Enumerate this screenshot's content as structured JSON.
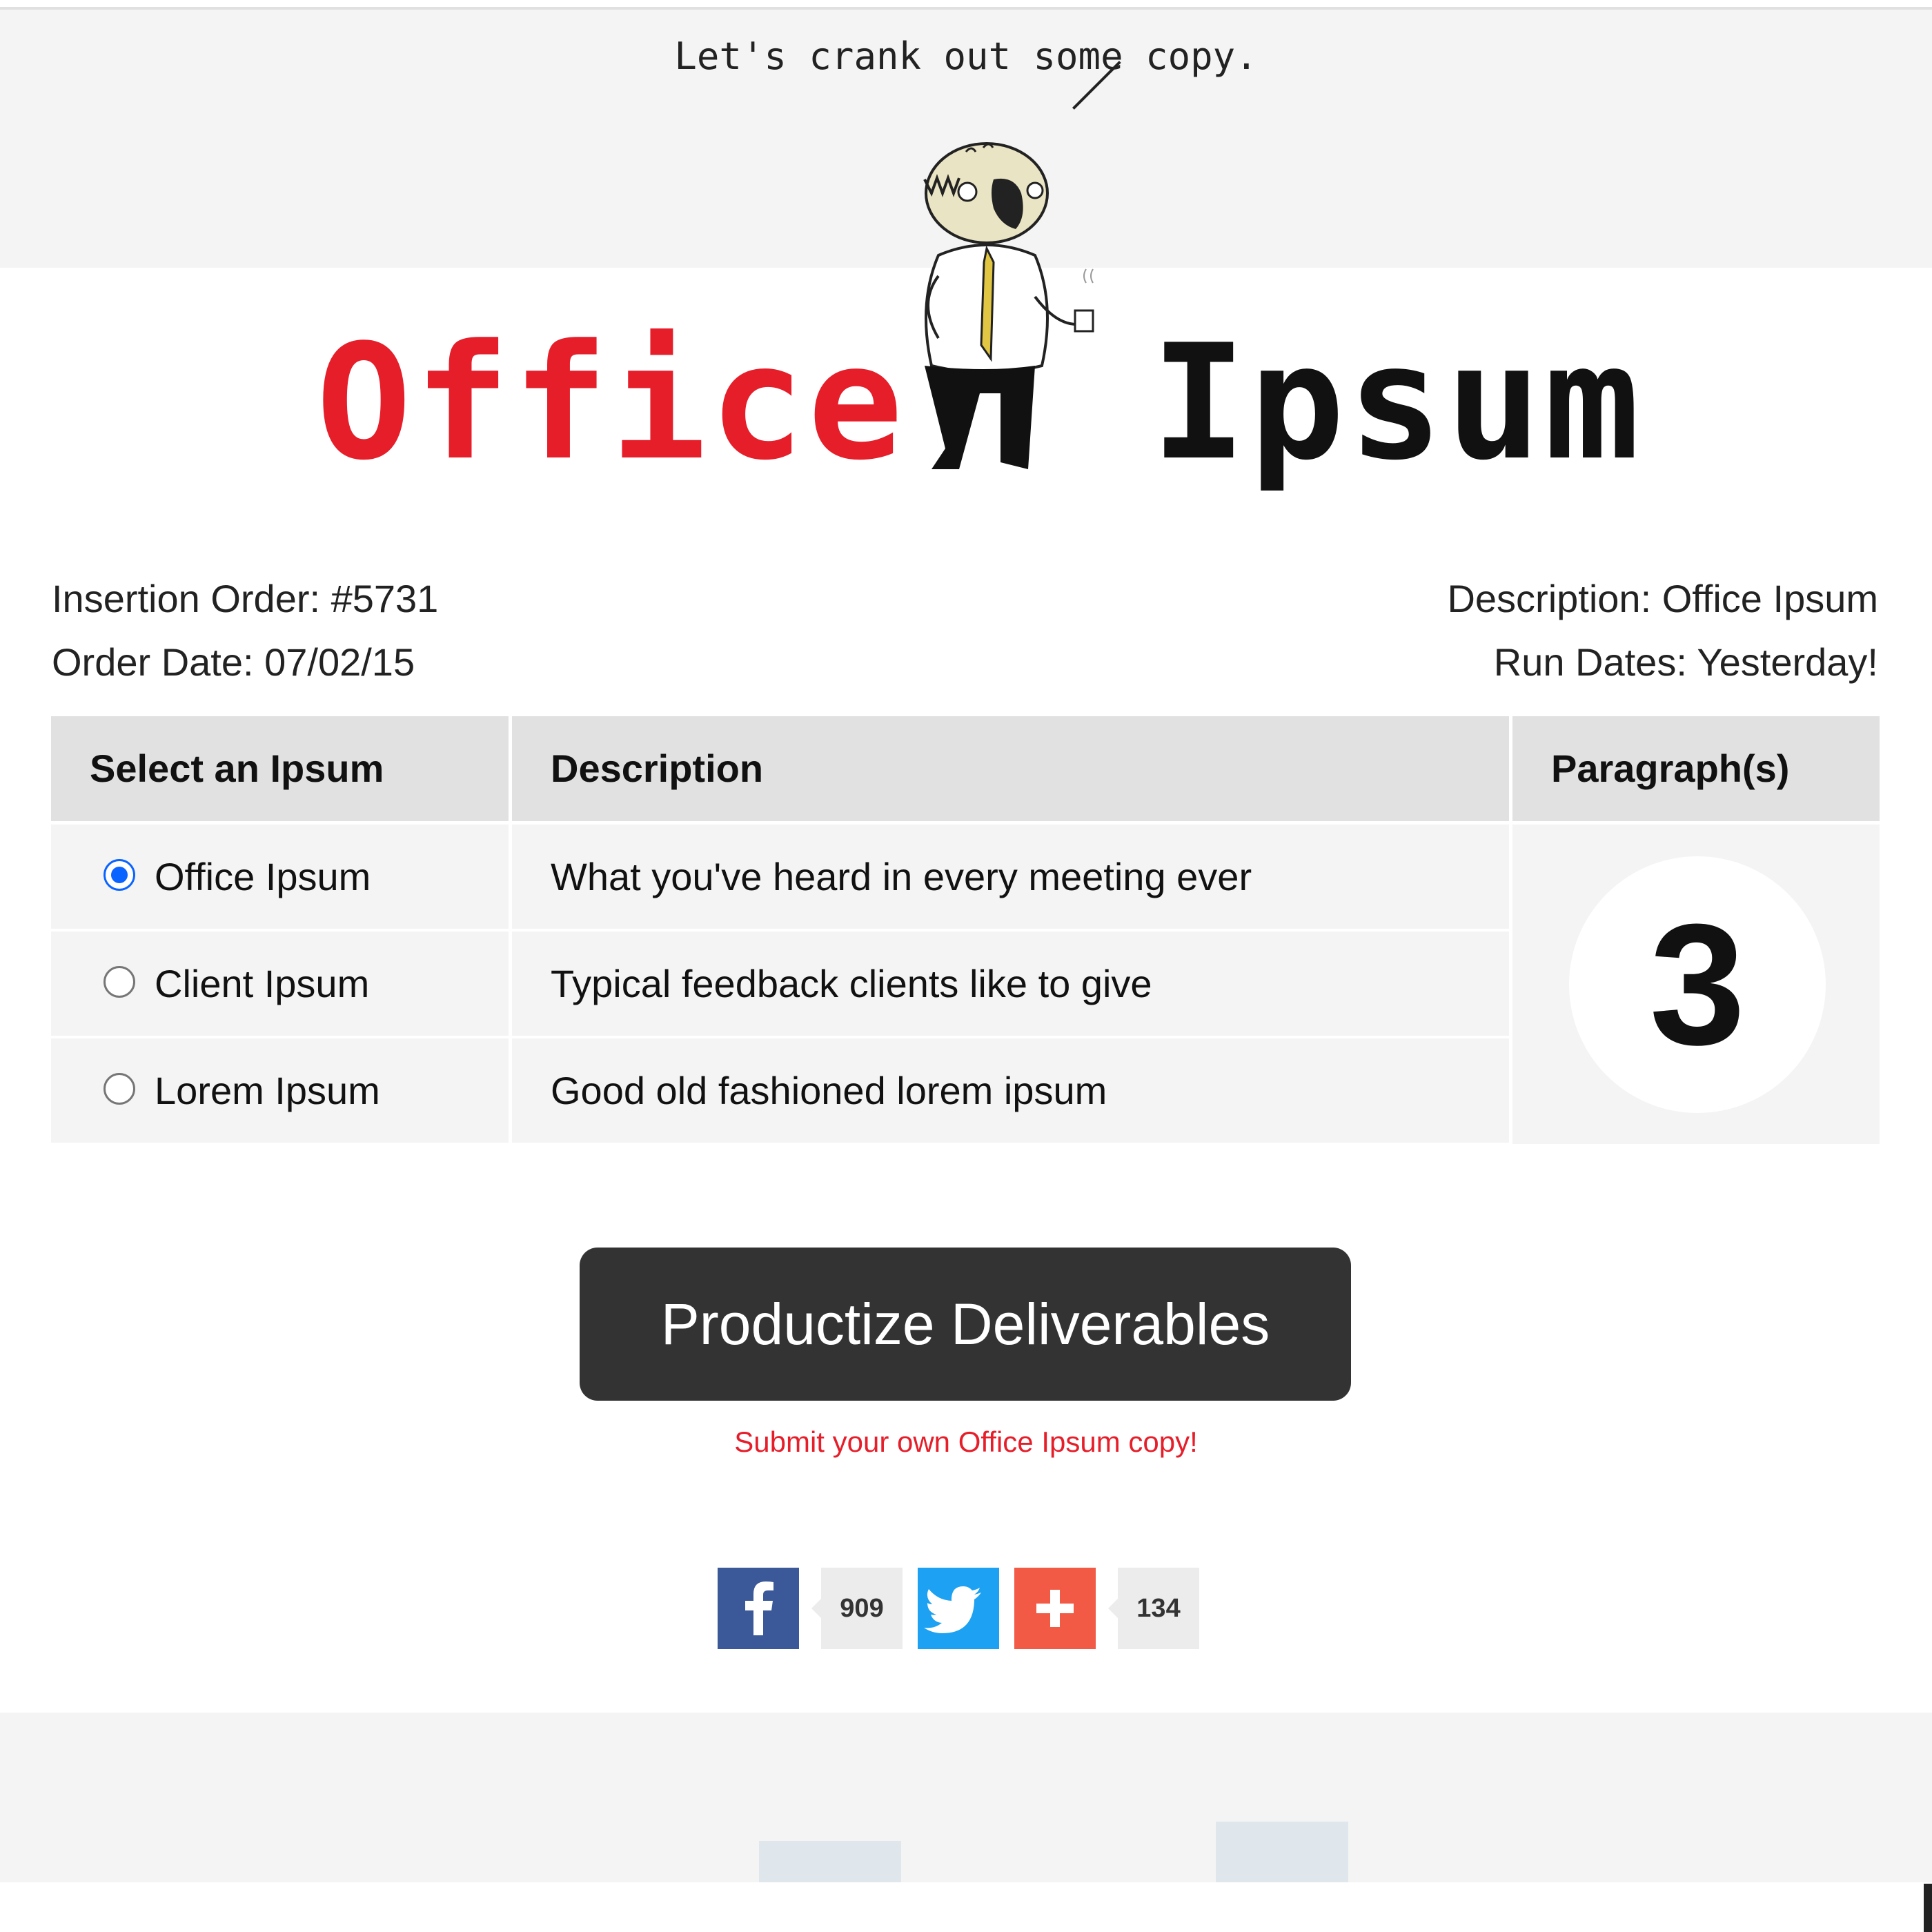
{
  "header": {
    "speech": "Let's crank out some copy."
  },
  "logo": {
    "word1": "Office",
    "word2": "Ipsum",
    "word1_color": "#e61e2a",
    "word2_color": "#111111"
  },
  "order": {
    "insertion_order": "Insertion Order: #5731",
    "order_date": "Order Date: 07/02/15",
    "description": "Description: Office Ipsum",
    "run_dates": "Run Dates: Yesterday!"
  },
  "table": {
    "headers": [
      "Select an Ipsum",
      "Description",
      "Paragraph(s)"
    ],
    "rows": [
      {
        "label": "Office Ipsum",
        "description": "What you've heard in every meeting ever",
        "selected": true
      },
      {
        "label": "Client Ipsum",
        "description": "Typical feedback clients like to give",
        "selected": false
      },
      {
        "label": "Lorem Ipsum",
        "description": "Good old fashioned lorem ipsum",
        "selected": false
      }
    ],
    "paragraphs": "3"
  },
  "cta": {
    "label": "Productize Deliverables",
    "submit_link": "Submit your own Office Ipsum copy!"
  },
  "share": {
    "facebook_count": "909",
    "plus_count": "134",
    "facebook_icon": "facebook-icon",
    "twitter_icon": "twitter-icon",
    "plus_icon": "plus-icon",
    "facebook_color": "#3b5998",
    "twitter_color": "#1da1f2",
    "plus_color": "#f25a45"
  },
  "colors": {
    "accent_red": "#e61e2a",
    "radio_blue": "#0a64ff",
    "button_dark": "#333333"
  }
}
